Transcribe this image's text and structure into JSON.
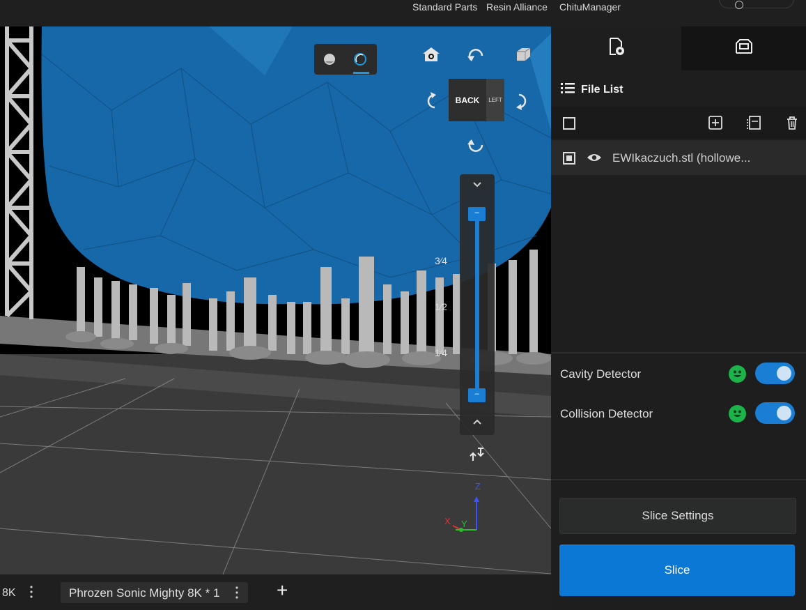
{
  "top_nav": {
    "links": [
      "Standard Parts",
      "Resin Alliance",
      "ChituManager"
    ]
  },
  "viewport": {
    "render_mode_icons": [
      "solid-sphere-icon",
      "xray-sphere-icon"
    ],
    "view_buttons": [
      "home-view-icon",
      "rotate-up-icon",
      "perspective-cube-icon",
      "rotate-left-icon",
      "rotate-right-icon",
      "rotate-down-icon"
    ],
    "view_cube": {
      "front_face": "BACK",
      "side_face": "LEFT"
    },
    "layer_slider": {
      "fractions": [
        "3⁄4",
        "1⁄2",
        "1⁄4"
      ],
      "upper_handle_label": "–",
      "lower_handle_label": "–",
      "upper_fraction": 1.0,
      "lower_fraction": 0.0
    },
    "axes": {
      "x": "X",
      "y": "Y",
      "z": "Z"
    },
    "colors": {
      "model": "#1668a8",
      "supports": "#bdbdbd",
      "floor": "#3a3a3a",
      "accent": "#1a7fd4"
    }
  },
  "right_panel": {
    "tabs": [
      "file-settings-icon",
      "printer-icon"
    ],
    "file_list_title": "File List",
    "toolbar_icons": [
      "add-file-icon",
      "duplicate-icon",
      "trash-icon"
    ],
    "files": [
      {
        "name": "EWIkaczuch.stl (hollowe...",
        "visible": true,
        "selected": true
      }
    ],
    "detectors": [
      {
        "label": "Cavity Detector",
        "status": "ok",
        "enabled": true
      },
      {
        "label": "Collision Detector",
        "status": "ok",
        "enabled": true
      }
    ],
    "slice_settings_label": "Slice Settings",
    "slice_label": "Slice"
  },
  "bottom_bar": {
    "prev_tab_fragment": "8K",
    "printer_tab": "Phrozen Sonic Mighty 8K * 1",
    "add_label": "+"
  }
}
